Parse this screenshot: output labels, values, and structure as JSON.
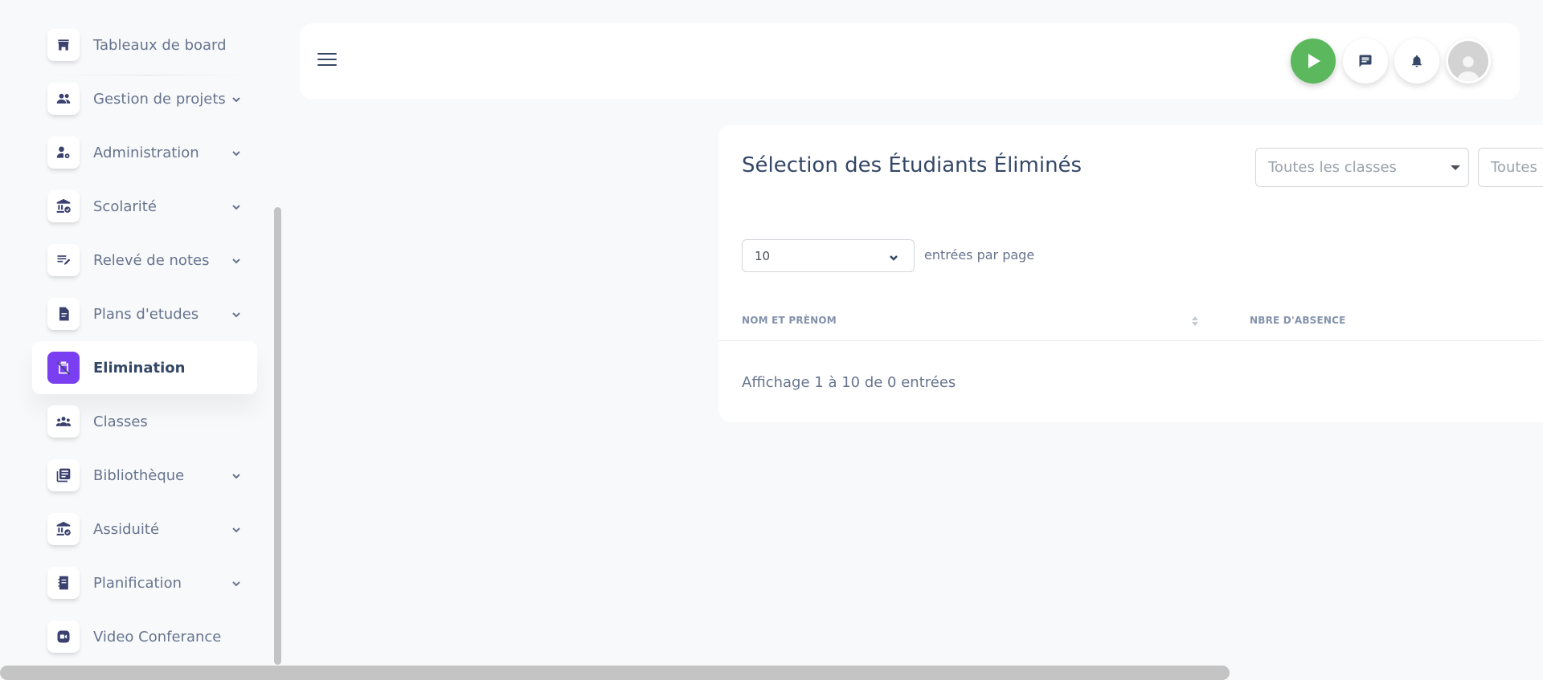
{
  "sidebar": {
    "items": [
      {
        "label": "Tableaux de board",
        "icon": "shop-icon",
        "has_chevron": false,
        "active": false
      },
      {
        "label": "Gestion de projets",
        "icon": "users-icon",
        "has_chevron": true,
        "active": false
      },
      {
        "label": "Administration",
        "icon": "user-gear-icon",
        "has_chevron": true,
        "active": false
      },
      {
        "label": "Scolarité",
        "icon": "institution-check-icon",
        "has_chevron": true,
        "active": false
      },
      {
        "label": "Relevé de notes",
        "icon": "list-edit-icon",
        "has_chevron": true,
        "active": false
      },
      {
        "label": "Plans d'etudes",
        "icon": "document-icon",
        "has_chevron": true,
        "active": false
      },
      {
        "label": "Elimination",
        "icon": "clipboard-off-icon",
        "has_chevron": false,
        "active": true
      },
      {
        "label": "Classes",
        "icon": "group-icon",
        "has_chevron": false,
        "active": false
      },
      {
        "label": "Bibliothèque",
        "icon": "library-icon",
        "has_chevron": true,
        "active": false
      },
      {
        "label": "Assiduité",
        "icon": "institution-check-icon",
        "has_chevron": true,
        "active": false
      },
      {
        "label": "Planification",
        "icon": "notebook-icon",
        "has_chevron": true,
        "active": false
      },
      {
        "label": "Video Conferance",
        "icon": "video-icon",
        "has_chevron": false,
        "active": false
      }
    ],
    "active_color": "#7b3ff2"
  },
  "navbar": {
    "menu_icon": "hamburger-icon",
    "buttons": [
      "play-icon",
      "chat-icon",
      "bell-icon",
      "avatar-icon"
    ],
    "play_color": "#5cb85c"
  },
  "card": {
    "title": "Sélection des Étudiants Éliminés",
    "filters": [
      {
        "placeholder": "Toutes les classes"
      },
      {
        "placeholder": "Toutes l"
      }
    ],
    "entries": {
      "value": "10",
      "label": "entrées par page"
    },
    "columns": [
      "NOM ET PRÈNOM",
      "NBRE D'ABSENCE"
    ],
    "info": "Affichage 1 à 10 de 0 entrées"
  }
}
